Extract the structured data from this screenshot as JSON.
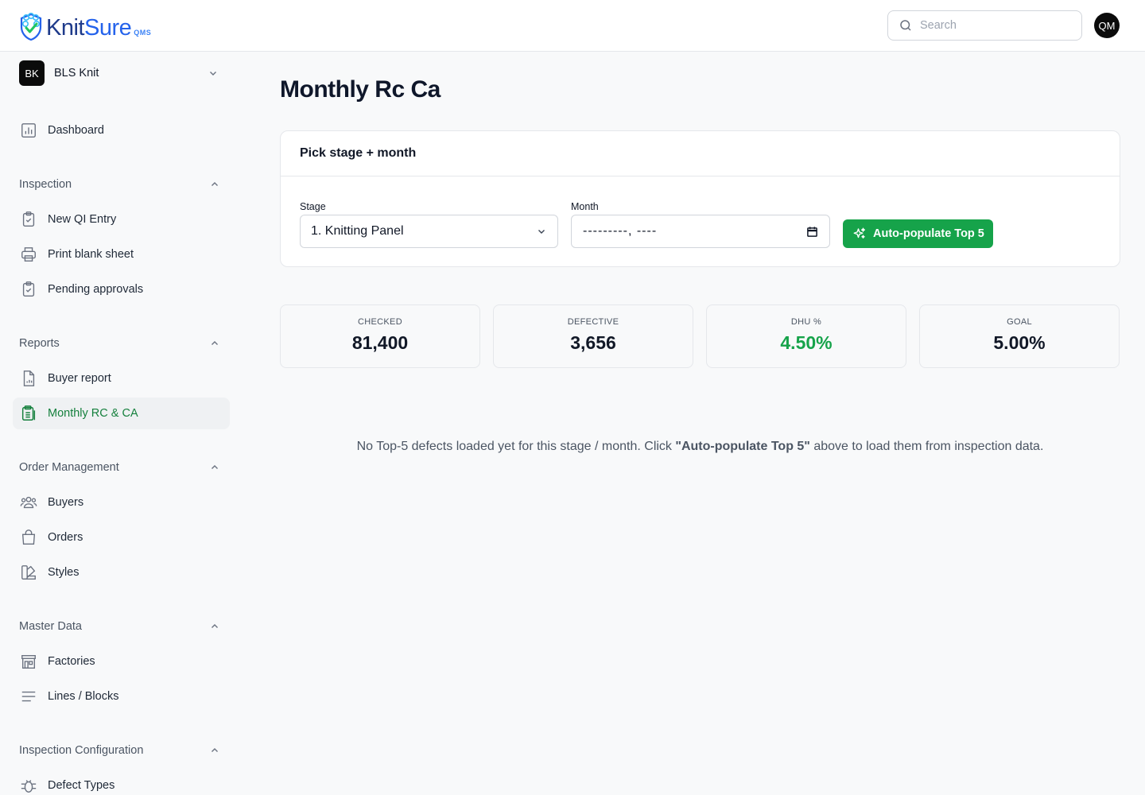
{
  "app": {
    "name_a": "Knit",
    "name_b": "Sure",
    "sub": "QMS"
  },
  "header": {
    "search_placeholder": "Search",
    "avatar": "QM"
  },
  "org": {
    "badge": "BK",
    "name": "BLS Knit"
  },
  "sidebar": {
    "dashboard": "Dashboard",
    "sections": {
      "inspection": "Inspection",
      "reports": "Reports",
      "orders": "Order Management",
      "master": "Master Data",
      "config": "Inspection Configuration"
    },
    "items": {
      "new_qi": "New QI Entry",
      "print_blank": "Print blank sheet",
      "pending": "Pending approvals",
      "buyer_report": "Buyer report",
      "monthly": "Monthly RC & CA",
      "buyers": "Buyers",
      "orders": "Orders",
      "styles": "Styles",
      "factories": "Factories",
      "lines": "Lines / Blocks",
      "defect_types": "Defect Types"
    }
  },
  "page": {
    "title": "Monthly Rc Ca",
    "card_title": "Pick stage + month",
    "stage_label": "Stage",
    "stage_value": "1. Knitting Panel",
    "month_label": "Month",
    "month_value": "---------, ----",
    "button": "Auto-populate Top 5"
  },
  "stats": [
    {
      "label": "CHECKED",
      "value": "81,400"
    },
    {
      "label": "DEFECTIVE",
      "value": "3,656"
    },
    {
      "label": "DHU %",
      "value": "4.50%"
    },
    {
      "label": "GOAL",
      "value": "5.00%"
    }
  ],
  "empty": {
    "pre": "No Top-5 defects loaded yet for this stage / month. Click ",
    "bold": "\"Auto-populate Top 5\"",
    "post": " above to load them from inspection data."
  },
  "colors": {
    "accent": "#16a34a",
    "active_text": "#15803d",
    "brand": "#2563eb"
  }
}
